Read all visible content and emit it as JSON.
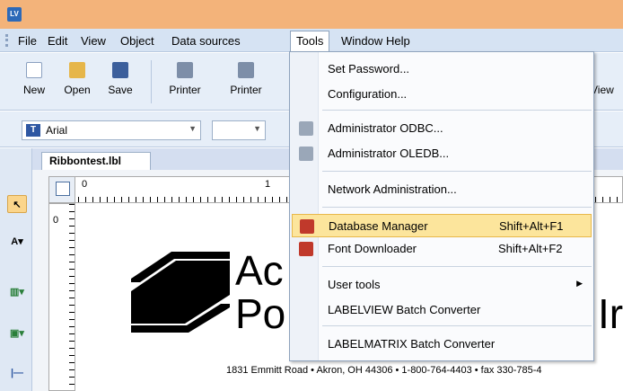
{
  "app_icon": "LV",
  "menubar": {
    "items": [
      "File",
      "Edit",
      "View",
      "Object",
      "Data sources",
      "Tools",
      "Window",
      "Help"
    ],
    "open_menu": "Tools"
  },
  "toolbar": {
    "buttons": [
      "New",
      "Open",
      "Save",
      "Printer",
      "Printer"
    ],
    "right_label": "View"
  },
  "formatbar": {
    "font_name": "Arial"
  },
  "document": {
    "tab": "Ribbontest.lbl"
  },
  "rulers": {
    "top_0": "0",
    "top_1": "1",
    "left_0": "0"
  },
  "label_content": {
    "line1": "Ac",
    "line2": "Po",
    "suffix": "Ir",
    "address": "1831 Emmitt Road • Akron, OH 44306 • 1-800-764-4403 • fax 330-785-4"
  },
  "tools_menu": {
    "set_password": "Set Password...",
    "configuration": "Configuration...",
    "admin_odbc": "Administrator ODBC...",
    "admin_oledb": "Administrator OLEDB...",
    "network_admin": "Network Administration...",
    "database_manager": "Database Manager",
    "database_manager_shortcut": "Shift+Alt+F1",
    "font_downloader": "Font Downloader",
    "font_downloader_shortcut": "Shift+Alt+F2",
    "user_tools": "User tools",
    "labelview_batch": "LABELVIEW Batch Converter",
    "labelmatrix_batch": "LABELMATRIX Batch Converter"
  },
  "colors": {
    "titlebar": "#f3b37a",
    "menubar": "#d6e3f3",
    "highlight": "#fce59c"
  }
}
